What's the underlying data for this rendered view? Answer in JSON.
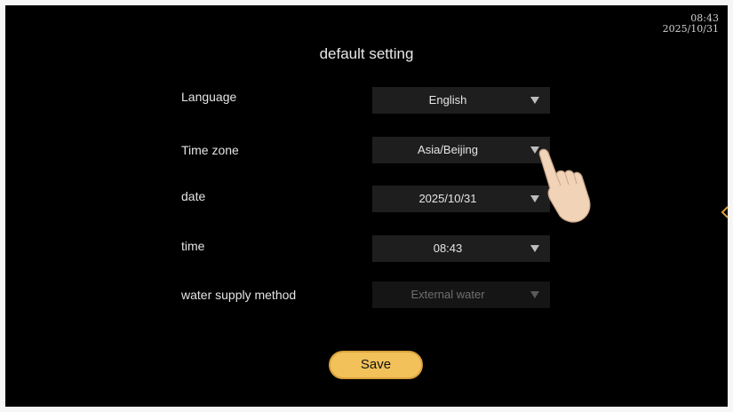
{
  "status": {
    "time": "08:43",
    "date": "2025/10/31"
  },
  "page": {
    "title": "default setting"
  },
  "settings": [
    {
      "label": "Language",
      "value": "English",
      "enabled": true
    },
    {
      "label": "Time zone",
      "value": "Asia/Beijing",
      "enabled": true
    },
    {
      "label": "date",
      "value": "2025/10/31",
      "enabled": true
    },
    {
      "label": "time",
      "value": "08:43",
      "enabled": true
    },
    {
      "label": "water supply method",
      "value": "External water",
      "enabled": false
    }
  ],
  "actions": {
    "save_label": "Save"
  },
  "icons": {
    "dropdown": "chevron-down-icon",
    "side": "chevron-left-icon",
    "pointer": "pointing-hand-icon"
  },
  "colors": {
    "background": "#000000",
    "accent": "#f2c15a",
    "select_bg": "#1e1e1e"
  }
}
